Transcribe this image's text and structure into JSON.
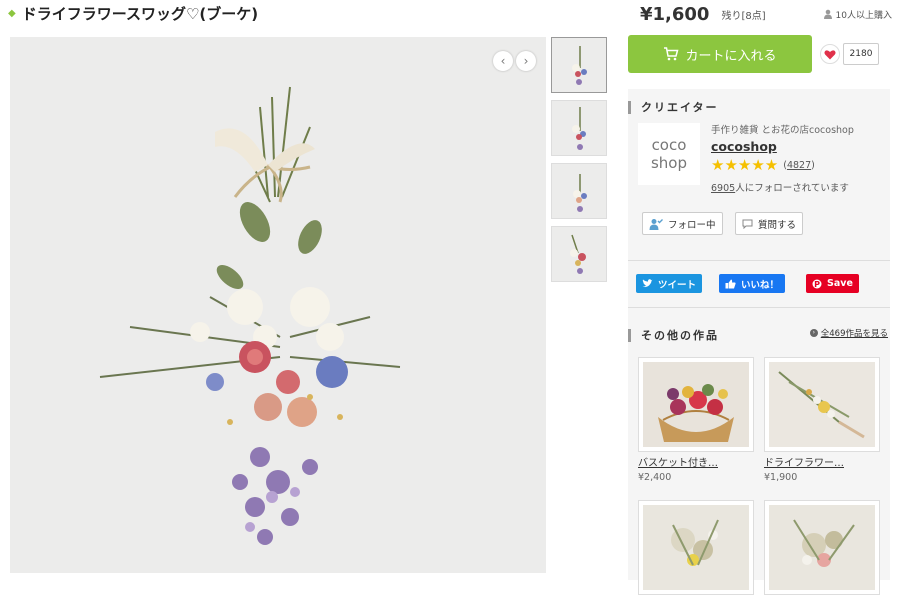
{
  "product": {
    "title": "ドライフラワースワッグ♡(ブーケ)",
    "price": "¥1,600",
    "stock": "残り[8点]",
    "buyers": "10人以上購入"
  },
  "actions": {
    "cart_label": "カートに入れる",
    "fav_count": "2180"
  },
  "creator": {
    "section_label": "クリエイター",
    "logo_line1": "coco",
    "logo_line2": "shop",
    "shop_subtitle": "手作り雑貨 とお花の店cocoshop",
    "shop_name": "cocoshop",
    "stars": "★★★★★",
    "review_count": "4827",
    "followers": "6905",
    "followers_suffix": "人にフォローされています",
    "follow_label": "フォロー中",
    "question_label": "質問する"
  },
  "share": {
    "tweet": "ツイート",
    "like": "いいね！",
    "save": "Save"
  },
  "other_works": {
    "section_label": "その他の作品",
    "see_all": "全469作品を見る",
    "items": [
      {
        "name": "バスケット付き…",
        "price": "¥2,400"
      },
      {
        "name": "ドライフラワー…",
        "price": "¥1,900"
      },
      {
        "name": "",
        "price": ""
      },
      {
        "name": "",
        "price": ""
      }
    ]
  },
  "icons": {
    "prev": "chevron-left-icon",
    "next": "chevron-right-icon",
    "cart": "cart-icon",
    "heart": "heart-icon",
    "user": "user-icon"
  },
  "colors": {
    "accent_green": "#8cc63f",
    "twitter": "#1b95e0",
    "facebook": "#1877f2",
    "pinterest": "#e60023",
    "star": "#f5c000",
    "heart": "#e0304a"
  }
}
